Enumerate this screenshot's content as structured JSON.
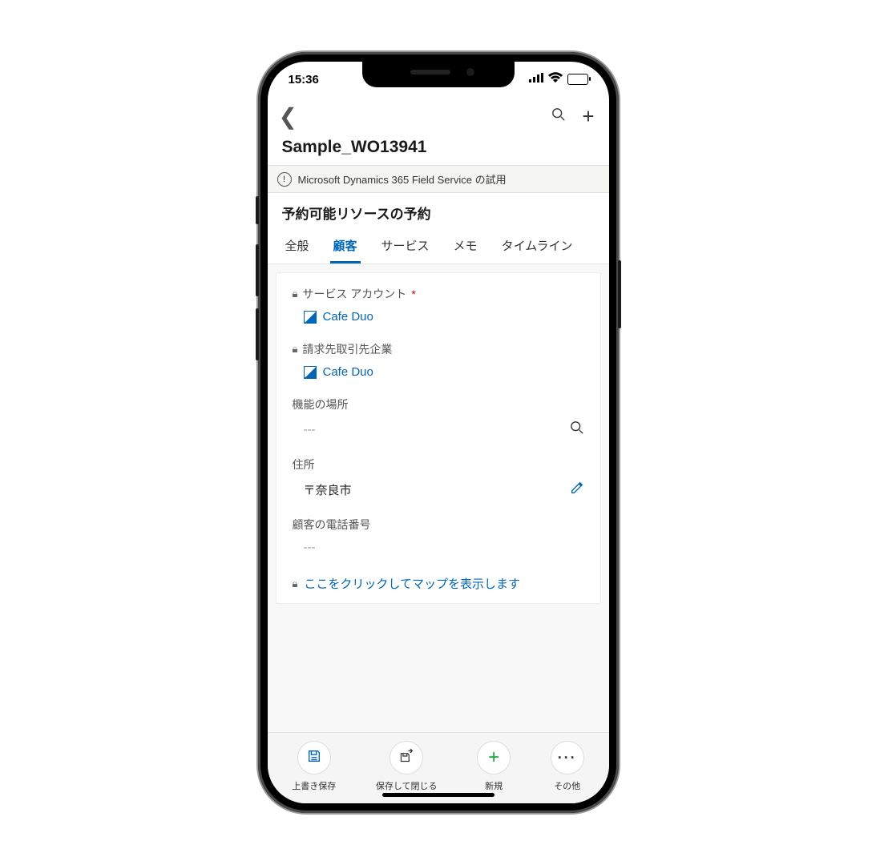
{
  "statusbar": {
    "time": "15:36"
  },
  "header": {
    "title": "Sample_WO13941",
    "trial_text": "Microsoft Dynamics 365 Field Service の試用",
    "subtitle": "予約可能リソースの予約"
  },
  "tabs": [
    {
      "label": "全般",
      "active": false
    },
    {
      "label": "顧客",
      "active": true
    },
    {
      "label": "サービス",
      "active": false
    },
    {
      "label": "メモ",
      "active": false
    },
    {
      "label": "タイムライン",
      "active": false
    }
  ],
  "fields": {
    "service_account": {
      "label": "サービス アカウント",
      "required": true,
      "locked": true,
      "value": "Cafe Duo"
    },
    "billing_account": {
      "label": "請求先取引先企業",
      "locked": true,
      "value": "Cafe Duo"
    },
    "functional_location": {
      "label": "機能の場所",
      "value": "---"
    },
    "address": {
      "label": "住所",
      "value": "〒奈良市"
    },
    "customer_phone": {
      "label": "顧客の電話番号",
      "value": "---"
    },
    "map_link": {
      "label": "ここをクリックしてマップを表示します",
      "locked": true
    }
  },
  "bottom": [
    {
      "label": "上書き保存",
      "name": "save-button",
      "icon": "save"
    },
    {
      "label": "保存して閉じる",
      "name": "save-close-button",
      "icon": "save-close"
    },
    {
      "label": "新規",
      "name": "new-button",
      "icon": "plus"
    },
    {
      "label": "その他",
      "name": "more-button",
      "icon": "more"
    }
  ]
}
